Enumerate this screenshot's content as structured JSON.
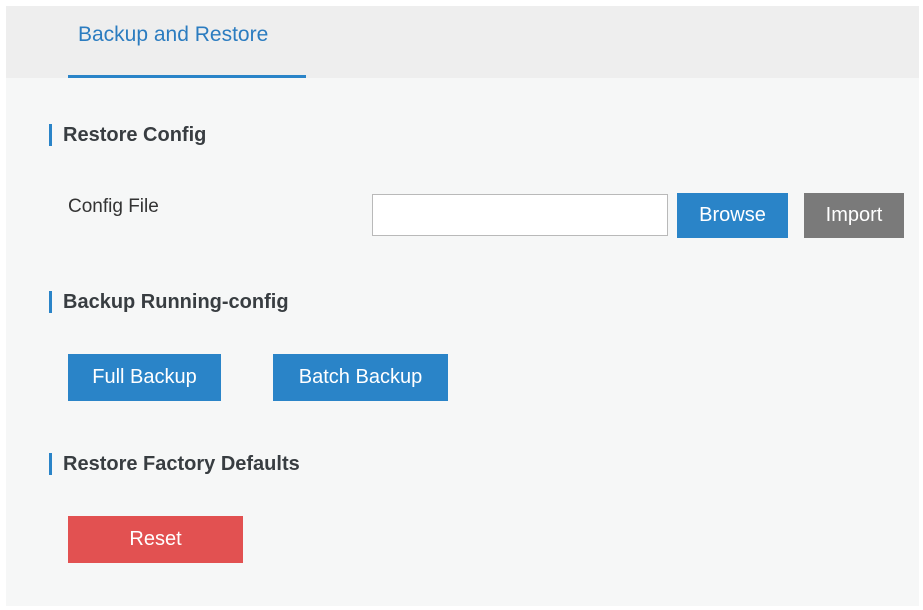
{
  "tabs": [
    {
      "label": "Backup and Restore",
      "active": true
    }
  ],
  "restore_config": {
    "title": "Restore Config",
    "config_file_label": "Config File",
    "config_file_value": "",
    "config_file_placeholder": "",
    "browse_label": "Browse",
    "import_label": "Import"
  },
  "backup_running_config": {
    "title": "Backup Running-config",
    "full_backup_label": "Full Backup",
    "batch_backup_label": "Batch Backup"
  },
  "restore_factory_defaults": {
    "title": "Restore Factory Defaults",
    "reset_label": "Reset"
  },
  "colors": {
    "accent": "#2a84c8",
    "tab_text": "#2b7cc0",
    "import_button": "#7a7a7a",
    "reset_button": "#e25151",
    "page_background": "#f6f7f7",
    "tab_bar_background": "#eeeeee"
  }
}
